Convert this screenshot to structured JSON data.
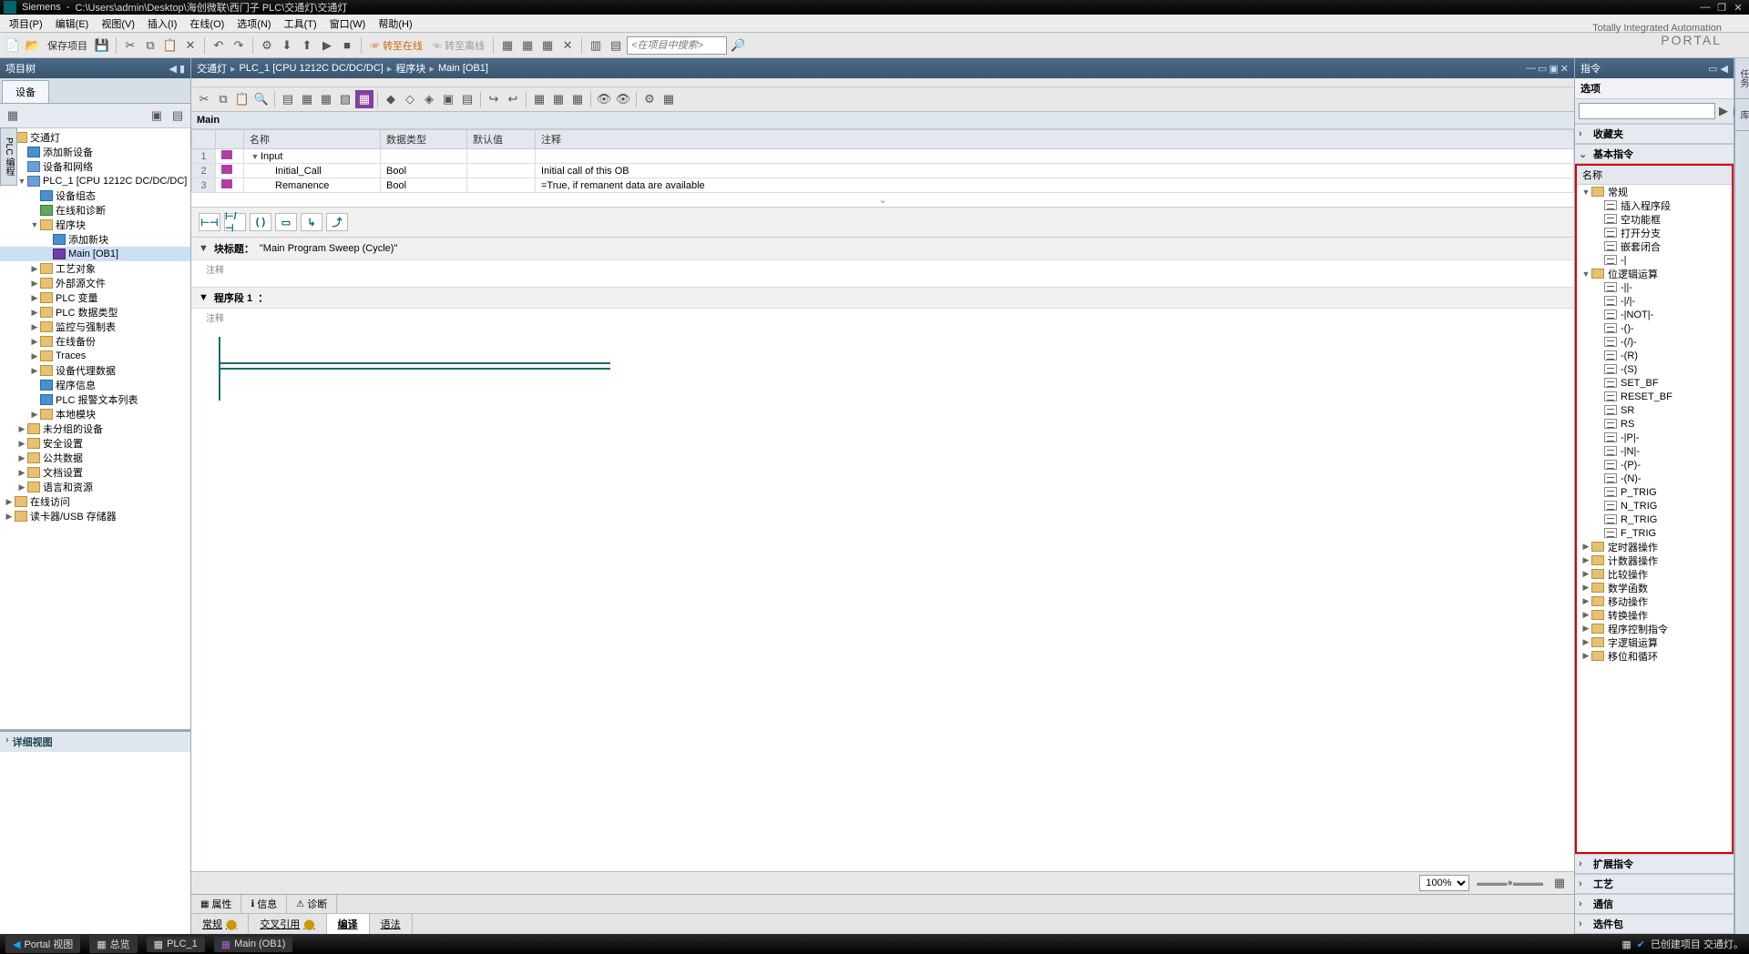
{
  "titlebar": {
    "app": "Siemens",
    "sep": "-",
    "path": "C:\\Users\\admin\\Desktop\\海创微联\\西门子 PLC\\交通灯\\交通灯"
  },
  "menus": [
    "项目(P)",
    "编辑(E)",
    "视图(V)",
    "插入(I)",
    "在线(O)",
    "选项(N)",
    "工具(T)",
    "窗口(W)",
    "帮助(H)"
  ],
  "toolbar": {
    "save": "保存项目",
    "go_online": "转至在线",
    "go_offline": "转至离线",
    "search_ph": "<在项目中搜索>"
  },
  "branding": {
    "l1": "Totally Integrated Automation",
    "l2": "PORTAL"
  },
  "left": {
    "title": "项目树",
    "tab": "设备",
    "tree": [
      {
        "d": 0,
        "tw": "▼",
        "ic": "ic-folder",
        "t": "交通灯"
      },
      {
        "d": 1,
        "tw": "",
        "ic": "ic-blue",
        "t": "添加新设备"
      },
      {
        "d": 1,
        "tw": "",
        "ic": "ic-dev",
        "t": "设备和网络"
      },
      {
        "d": 1,
        "tw": "▼",
        "ic": "ic-dev",
        "t": "PLC_1 [CPU 1212C DC/DC/DC]"
      },
      {
        "d": 2,
        "tw": "",
        "ic": "ic-blue",
        "t": "设备组态"
      },
      {
        "d": 2,
        "tw": "",
        "ic": "ic-green",
        "t": "在线和诊断"
      },
      {
        "d": 2,
        "tw": "▼",
        "ic": "ic-folder",
        "t": "程序块"
      },
      {
        "d": 3,
        "tw": "",
        "ic": "ic-blue",
        "t": "添加新块"
      },
      {
        "d": 3,
        "tw": "",
        "ic": "ic-ob",
        "t": "Main [OB1]",
        "sel": true
      },
      {
        "d": 2,
        "tw": "▶",
        "ic": "ic-folder",
        "t": "工艺对象"
      },
      {
        "d": 2,
        "tw": "▶",
        "ic": "ic-folder",
        "t": "外部源文件"
      },
      {
        "d": 2,
        "tw": "▶",
        "ic": "ic-folder",
        "t": "PLC 变量"
      },
      {
        "d": 2,
        "tw": "▶",
        "ic": "ic-folder",
        "t": "PLC 数据类型"
      },
      {
        "d": 2,
        "tw": "▶",
        "ic": "ic-folder",
        "t": "监控与强制表"
      },
      {
        "d": 2,
        "tw": "▶",
        "ic": "ic-folder",
        "t": "在线备份"
      },
      {
        "d": 2,
        "tw": "▶",
        "ic": "ic-folder",
        "t": "Traces"
      },
      {
        "d": 2,
        "tw": "▶",
        "ic": "ic-folder",
        "t": "设备代理数据"
      },
      {
        "d": 2,
        "tw": "",
        "ic": "ic-blue",
        "t": "程序信息"
      },
      {
        "d": 2,
        "tw": "",
        "ic": "ic-blue",
        "t": "PLC 报警文本列表"
      },
      {
        "d": 2,
        "tw": "▶",
        "ic": "ic-folder",
        "t": "本地模块"
      },
      {
        "d": 1,
        "tw": "▶",
        "ic": "ic-folder",
        "t": "未分组的设备"
      },
      {
        "d": 1,
        "tw": "▶",
        "ic": "ic-folder",
        "t": "安全设置"
      },
      {
        "d": 1,
        "tw": "▶",
        "ic": "ic-folder",
        "t": "公共数据"
      },
      {
        "d": 1,
        "tw": "▶",
        "ic": "ic-folder",
        "t": "文档设置"
      },
      {
        "d": 1,
        "tw": "▶",
        "ic": "ic-folder",
        "t": "语言和资源"
      },
      {
        "d": 0,
        "tw": "▶",
        "ic": "ic-folder",
        "t": "在线访问"
      },
      {
        "d": 0,
        "tw": "▶",
        "ic": "ic-folder",
        "t": "读卡器/USB 存储器"
      }
    ],
    "lower": "详细视图",
    "side": "PLC 编程"
  },
  "center": {
    "crumbs": [
      "交通灯",
      "PLC_1 [CPU 1212C DC/DC/DC]",
      "程序块",
      "Main [OB1]"
    ],
    "section": "Main",
    "cols": [
      "名称",
      "数据类型",
      "默认值",
      "注释"
    ],
    "rows": [
      {
        "n": "1",
        "name": "Input",
        "type": "",
        "def": "",
        "cmt": "",
        "kind": "hdr"
      },
      {
        "n": "2",
        "name": "Initial_Call",
        "type": "Bool",
        "def": "",
        "cmt": "Initial call of this OB"
      },
      {
        "n": "3",
        "name": "Remanence",
        "type": "Bool",
        "def": "",
        "cmt": "=True, if remanent data are available"
      }
    ],
    "blk_title_lbl": "块标题：",
    "blk_title": "\"Main Program Sweep (Cycle)\"",
    "cmt": "注释",
    "net_lbl": "程序段 1",
    "net_colon": "：",
    "net_cmt": "注释",
    "zoom": "100%",
    "prop_tabs": [
      "属性",
      "信息",
      "诊断"
    ],
    "bottom_tabs": [
      "常规",
      "交叉引用",
      "编译",
      "语法"
    ]
  },
  "right": {
    "title": "指令",
    "options": "选项",
    "fav": "收藏夹",
    "basic": "基本指令",
    "col": "名称",
    "tree": [
      {
        "d": 0,
        "tw": "▼",
        "ic": "ii-fold",
        "t": "常规"
      },
      {
        "d": 1,
        "tw": "",
        "ic": "ii-fn",
        "t": "插入程序段"
      },
      {
        "d": 1,
        "tw": "",
        "ic": "ii-fn",
        "t": "空功能框"
      },
      {
        "d": 1,
        "tw": "",
        "ic": "ii-fn",
        "t": "打开分支"
      },
      {
        "d": 1,
        "tw": "",
        "ic": "ii-fn",
        "t": "嵌套闭合"
      },
      {
        "d": 1,
        "tw": "",
        "ic": "ii-fn",
        "t": "-|"
      },
      {
        "d": 0,
        "tw": "▼",
        "ic": "ii-fold",
        "t": "位逻辑运算"
      },
      {
        "d": 1,
        "tw": "",
        "ic": "ii-fn",
        "t": "-||-"
      },
      {
        "d": 1,
        "tw": "",
        "ic": "ii-fn",
        "t": "-|/|-"
      },
      {
        "d": 1,
        "tw": "",
        "ic": "ii-fn",
        "t": "-|NOT|-"
      },
      {
        "d": 1,
        "tw": "",
        "ic": "ii-fn",
        "t": "-()-"
      },
      {
        "d": 1,
        "tw": "",
        "ic": "ii-fn",
        "t": "-(/)-"
      },
      {
        "d": 1,
        "tw": "",
        "ic": "ii-fn",
        "t": "-(R)"
      },
      {
        "d": 1,
        "tw": "",
        "ic": "ii-fn",
        "t": "-(S)"
      },
      {
        "d": 1,
        "tw": "",
        "ic": "ii-fn",
        "t": "SET_BF"
      },
      {
        "d": 1,
        "tw": "",
        "ic": "ii-fn",
        "t": "RESET_BF"
      },
      {
        "d": 1,
        "tw": "",
        "ic": "ii-fn",
        "t": "SR"
      },
      {
        "d": 1,
        "tw": "",
        "ic": "ii-fn",
        "t": "RS"
      },
      {
        "d": 1,
        "tw": "",
        "ic": "ii-fn",
        "t": "-|P|-"
      },
      {
        "d": 1,
        "tw": "",
        "ic": "ii-fn",
        "t": "-|N|-"
      },
      {
        "d": 1,
        "tw": "",
        "ic": "ii-fn",
        "t": "-(P)-"
      },
      {
        "d": 1,
        "tw": "",
        "ic": "ii-fn",
        "t": "-(N)-"
      },
      {
        "d": 1,
        "tw": "",
        "ic": "ii-fn",
        "t": "P_TRIG"
      },
      {
        "d": 1,
        "tw": "",
        "ic": "ii-fn",
        "t": "N_TRIG"
      },
      {
        "d": 1,
        "tw": "",
        "ic": "ii-fn",
        "t": "R_TRIG"
      },
      {
        "d": 1,
        "tw": "",
        "ic": "ii-fn",
        "t": "F_TRIG"
      },
      {
        "d": 0,
        "tw": "▶",
        "ic": "ii-fold",
        "t": "定时器操作"
      },
      {
        "d": 0,
        "tw": "▶",
        "ic": "ii-fold",
        "t": "计数器操作"
      },
      {
        "d": 0,
        "tw": "▶",
        "ic": "ii-fold",
        "t": "比较操作"
      },
      {
        "d": 0,
        "tw": "▶",
        "ic": "ii-fold",
        "t": "数学函数"
      },
      {
        "d": 0,
        "tw": "▶",
        "ic": "ii-fold",
        "t": "移动操作"
      },
      {
        "d": 0,
        "tw": "▶",
        "ic": "ii-fold",
        "t": "转换操作"
      },
      {
        "d": 0,
        "tw": "▶",
        "ic": "ii-fold",
        "t": "程序控制指令"
      },
      {
        "d": 0,
        "tw": "▶",
        "ic": "ii-fold",
        "t": "字逻辑运算"
      },
      {
        "d": 0,
        "tw": "▶",
        "ic": "ii-fold",
        "t": "移位和循环"
      }
    ],
    "acc": [
      "扩展指令",
      "工艺",
      "通信",
      "选件包"
    ]
  },
  "status": {
    "portal": "Portal 视图",
    "overview": "总览",
    "tabs": [
      "PLC_1",
      "Main (OB1)"
    ],
    "msg": "已创建项目 交通灯。"
  }
}
